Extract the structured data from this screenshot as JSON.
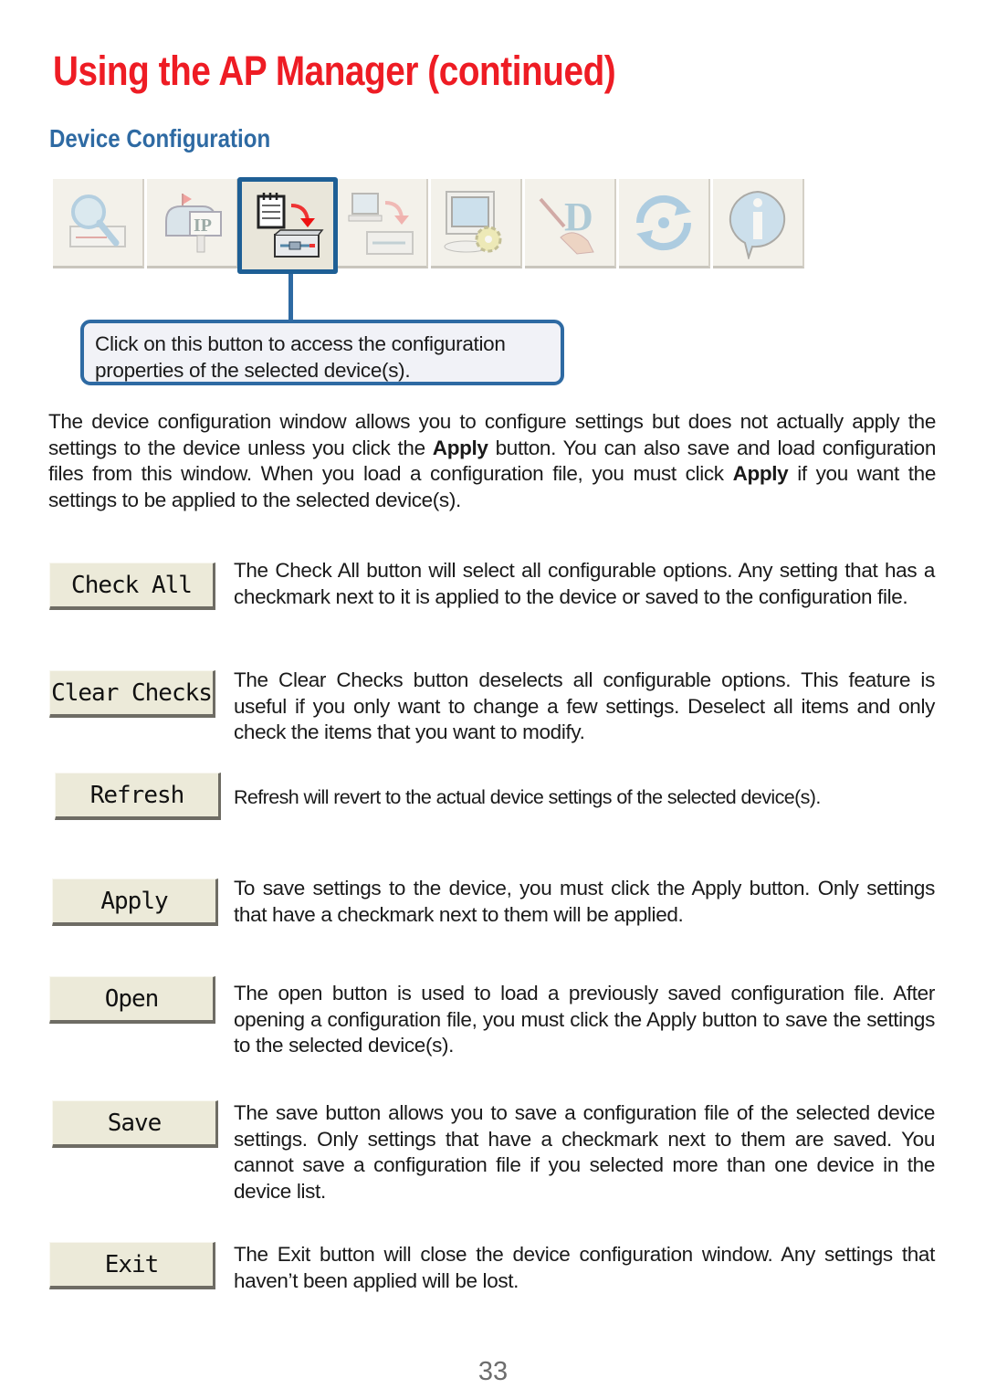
{
  "page": {
    "title": "Using the AP Manager (continued)",
    "section_title": "Device Configuration",
    "page_number": "33",
    "colors": {
      "title": "#ee1c24",
      "section": "#2e6aa3",
      "callout_border": "#2e6aa3"
    }
  },
  "toolbar": {
    "buttons": [
      {
        "icon": "search-device-icon",
        "state": "disabled"
      },
      {
        "icon": "ip-mailbox-icon",
        "state": "disabled"
      },
      {
        "icon": "device-configuration-icon",
        "state": "selected"
      },
      {
        "icon": "firmware-upgrade-icon",
        "state": "disabled"
      },
      {
        "icon": "system-settings-icon",
        "state": "disabled"
      },
      {
        "icon": "security-tools-icon",
        "state": "disabled"
      },
      {
        "icon": "refresh-icon",
        "state": "disabled"
      },
      {
        "icon": "info-icon",
        "state": "disabled"
      }
    ]
  },
  "callout": {
    "text": "Click on this button to access the configuration properties of the selected device(s)."
  },
  "intro": {
    "part1": "The device configuration window allows you to configure settings but does not actually apply the settings to the device unless you click the ",
    "bold1": "Apply",
    "part2": " button. You can also save and load configuration files from this window. When you load a configuration file, you must click ",
    "bold2": "Apply",
    "part3": " if you want the settings to be applied to the selected device(s)."
  },
  "buttons": [
    {
      "label": "Check All",
      "description": "The Check All button will select all configurable options. Any setting that has a checkmark next to it is applied to the device or saved to the configuration file."
    },
    {
      "label": "Clear Checks",
      "description": "The Clear Checks button deselects all configurable options. This feature is useful if you only want to change a few settings. Deselect all items and only check the items that you want to modify."
    },
    {
      "label": "Refresh",
      "description": "Refresh will revert to the actual device settings of the selected device(s)."
    },
    {
      "label": "Apply",
      "description": "To save settings to the device, you must click the Apply button. Only settings that have a checkmark next to them will be applied."
    },
    {
      "label": "Open",
      "description": "The open button is used to load a previously saved configuration file. After opening a configuration file, you must click the Apply button to save the settings to the selected device(s)."
    },
    {
      "label": "Save",
      "description": "The save button allows you to save a configuration file of the selected device settings. Only settings that have a checkmark next to them are saved. You cannot save a configuration file if you selected more than one device in the device list."
    },
    {
      "label": "Exit",
      "description": "The Exit button will close the device configuration window. Any settings that haven’t been applied will be lost."
    }
  ]
}
